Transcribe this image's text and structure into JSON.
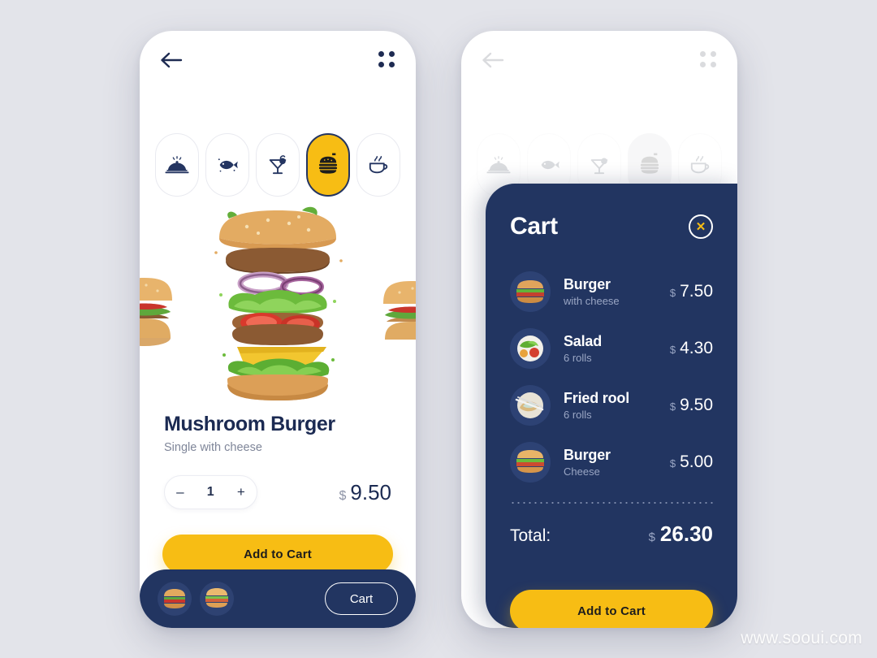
{
  "background_color": "#e3e4ea",
  "colors": {
    "navy": "#223561",
    "yellow": "#f7bd14",
    "text_dark": "#1b2a52",
    "muted": "#7f8699",
    "cart_muted": "#9aa6c4"
  },
  "watermark": "www.sooui.com",
  "screen_product": {
    "header": {
      "back_icon": "arrow-left-icon",
      "menu_icon": "grid-menu-icon"
    },
    "categories": [
      {
        "id": "dish",
        "icon": "cloche-dish-icon",
        "label": "Dishes",
        "active": false
      },
      {
        "id": "fish",
        "icon": "fish-icon",
        "label": "Seafood",
        "active": false
      },
      {
        "id": "drink",
        "icon": "cocktail-glass-icon",
        "label": "Drinks",
        "active": false
      },
      {
        "id": "burger",
        "icon": "burger-icon",
        "label": "Burgers",
        "active": true
      },
      {
        "id": "coffee",
        "icon": "coffee-cup-icon",
        "label": "Coffee",
        "active": false
      }
    ],
    "hero": {
      "image_name": "deconstructed-mushroom-burger",
      "peek_left_name": "previous-burger-preview",
      "peek_right_name": "next-burger-preview"
    },
    "product": {
      "title": "Mushroom Burger",
      "subtitle": "Single with cheese",
      "quantity": "1",
      "minus_label": "–",
      "plus_label": "+",
      "currency": "$",
      "price": "9.50"
    },
    "add_to_cart_label": "Add to Cart",
    "bottom_bar": {
      "avatars": [
        "burger-thumb-1",
        "burger-thumb-2"
      ],
      "cart_label": "Cart"
    }
  },
  "screen_cart": {
    "header": {
      "back_icon": "arrow-left-icon",
      "menu_icon": "grid-menu-icon"
    },
    "categories": [
      {
        "id": "dish",
        "icon": "cloche-dish-icon",
        "label": "Dishes",
        "active": false
      },
      {
        "id": "fish",
        "icon": "fish-icon",
        "label": "Seafood",
        "active": false
      },
      {
        "id": "drink",
        "icon": "cocktail-glass-icon",
        "label": "Drinks",
        "active": false
      },
      {
        "id": "burger",
        "icon": "burger-icon",
        "label": "Burgers",
        "active": true
      },
      {
        "id": "coffee",
        "icon": "coffee-cup-icon",
        "label": "Coffee",
        "active": false
      }
    ],
    "cart": {
      "title": "Cart",
      "close_label": "✕",
      "currency": "$",
      "items": [
        {
          "name": "Burger",
          "desc": "with cheese",
          "currency": "$",
          "price": "7.50",
          "thumb": "burger-thumb"
        },
        {
          "name": "Salad",
          "desc": "6 rolls",
          "currency": "$",
          "price": "4.30",
          "thumb": "salad-thumb"
        },
        {
          "name": "Fried rool",
          "desc": "6 rolls",
          "currency": "$",
          "price": "9.50",
          "thumb": "friedroll-thumb"
        },
        {
          "name": "Burger",
          "desc": "Cheese",
          "currency": "$",
          "price": "5.00",
          "thumb": "burger-thumb"
        }
      ],
      "total_label": "Total:",
      "total_currency": "$",
      "total_value": "26.30",
      "add_to_cart_label": "Add to Cart"
    }
  }
}
